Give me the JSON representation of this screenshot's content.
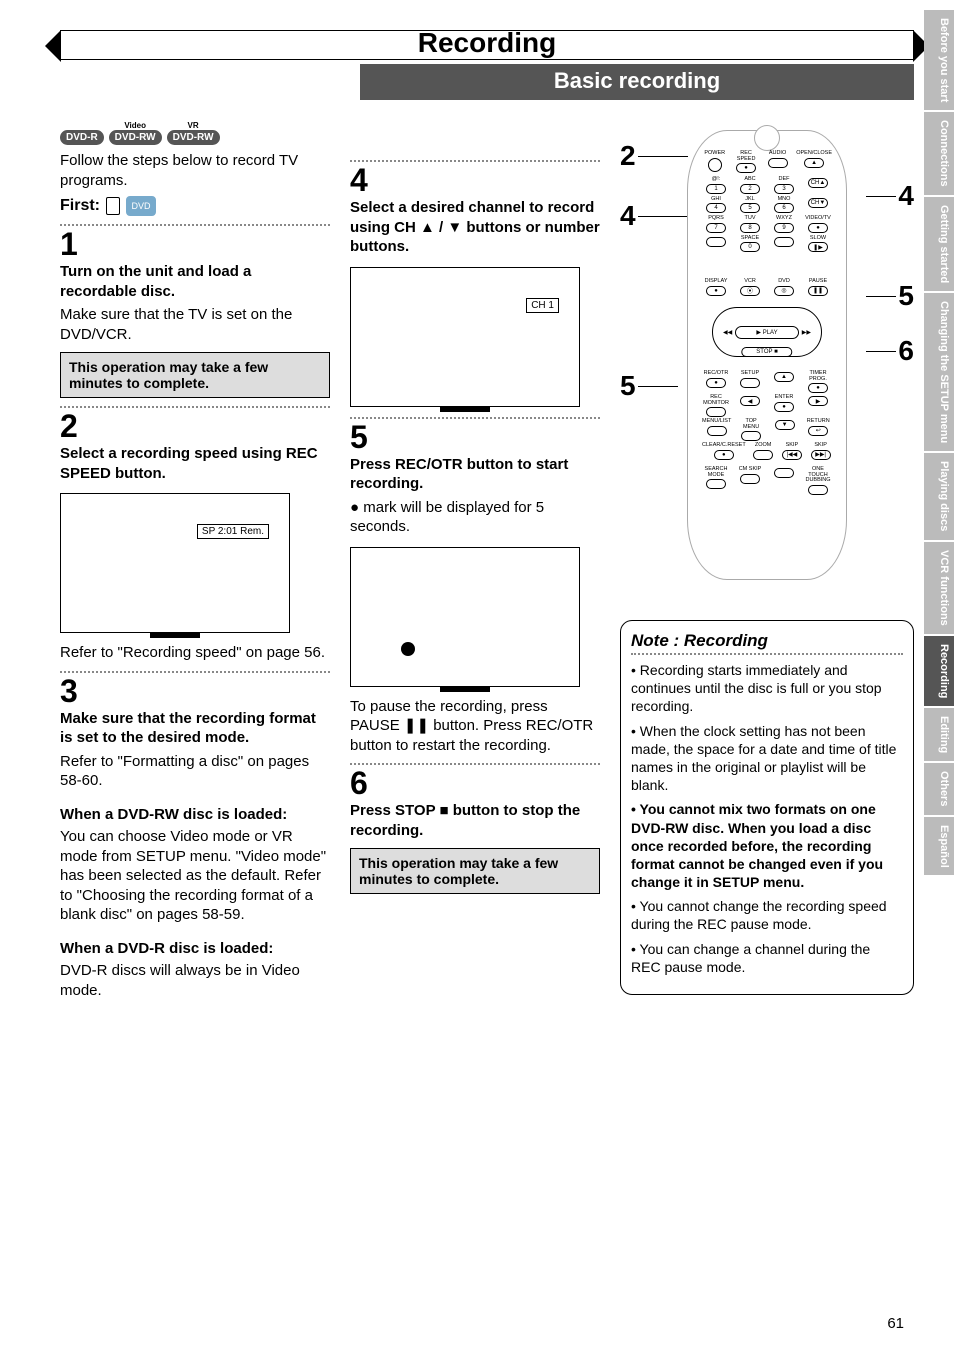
{
  "header": {
    "title": "Recording",
    "subtitle": "Basic recording"
  },
  "badges": [
    {
      "label": "DVD-R",
      "sup": ""
    },
    {
      "label": "DVD-RW",
      "sup": "Video"
    },
    {
      "label": "DVD-RW",
      "sup": "VR"
    }
  ],
  "intro": "Follow the steps below to record TV programs.",
  "first_label": "First:",
  "steps_left": {
    "s1": {
      "num": "1",
      "head": "Turn on the unit and load a recordable disc.",
      "body": "Make sure that the TV is set on the DVD/VCR.",
      "note": "This operation may take a few minutes to complete."
    },
    "s2": {
      "num": "2",
      "head": "Select a recording speed using REC SPEED button.",
      "tv_label": "SP 2:01 Rem.",
      "after": "Refer to \"Recording speed\" on page 56."
    },
    "s3": {
      "num": "3",
      "head": "Make sure that the recording format is set to the desired mode.",
      "body1": "Refer to \"Formatting a disc\" on pages 58-60.",
      "sub1_head": "When a DVD-RW disc is loaded:",
      "sub1_body": "You can choose Video mode or VR mode from SETUP menu. \"Video mode\" has been selected as the default. Refer to \"Choosing the recording format of a blank disc\" on pages 58-59.",
      "sub2_head": "When a DVD-R disc is loaded:",
      "sub2_body": "DVD-R discs will always be in Video mode."
    }
  },
  "steps_mid": {
    "s4": {
      "num": "4",
      "head": "Select a desired channel to record using CH ▲ / ▼ buttons or number buttons.",
      "tv_label": "CH 1"
    },
    "s5": {
      "num": "5",
      "head": "Press REC/OTR button to start recording.",
      "body": "● mark will be displayed for 5 seconds.",
      "after": "To pause the recording, press PAUSE ❚❚ button. Press REC/OTR button to restart the recording."
    },
    "s6": {
      "num": "6",
      "head": "Press STOP ■ button to stop the recording.",
      "note": "This operation may take a few minutes to complete."
    }
  },
  "remote": {
    "top_row": [
      "POWER",
      "REC SPEED",
      "AUDIO",
      "OPEN/CLOSE"
    ],
    "num_labels": [
      [
        "@!:",
        "ABC",
        "DEF",
        ""
      ],
      [
        "GHI",
        "JKL",
        "MNO",
        ""
      ],
      [
        "PQRS",
        "TUV",
        "WXYZ",
        "VIDEO/TV"
      ],
      [
        "",
        "SPACE",
        "",
        "SLOW"
      ]
    ],
    "num_digits": [
      [
        "1",
        "2",
        "3",
        "CH▲"
      ],
      [
        "4",
        "5",
        "6",
        "CH▼"
      ],
      [
        "7",
        "8",
        "9",
        "●"
      ],
      [
        "",
        "0",
        "",
        "❚▶"
      ]
    ],
    "mid_row_labels": [
      "DISPLAY",
      "VCR",
      "DVD",
      "PAUSE"
    ],
    "mid_row_btns": [
      "●",
      "⦿",
      "◎",
      "❚❚"
    ],
    "play": "▶  PLAY",
    "stop": "STOP ■",
    "rew": "◀◀",
    "ff": "▶▶",
    "lower1_labels": [
      "REC/OTR",
      "SETUP",
      "",
      "TIMER PROG."
    ],
    "lower1_btns": [
      "●",
      "",
      "▲",
      "●"
    ],
    "lower2_labels": [
      "REC MONITOR",
      "",
      "ENTER",
      ""
    ],
    "lower2_btns": [
      "",
      "◀",
      "●",
      "▶"
    ],
    "lower3_labels": [
      "MENU/LIST",
      "TOP MENU",
      "",
      "RETURN"
    ],
    "lower3_btns": [
      "",
      "",
      "▼",
      "↩"
    ],
    "lower4_labels": [
      "CLEAR/C.RESET",
      "ZOOM",
      "SKIP",
      "SKIP"
    ],
    "lower4_btns": [
      "●",
      "",
      "|◀◀",
      "▶▶|"
    ],
    "lower5_labels": [
      "SEARCH MODE",
      "CM SKIP",
      "",
      "ONE TOUCH DUBBING"
    ],
    "lower5_btns": [
      "",
      "",
      "",
      ""
    ]
  },
  "callouts": {
    "c2": "2",
    "c4l": "4",
    "c4r": "4",
    "c5l": "5",
    "c5r": "5",
    "c6": "6"
  },
  "note_block": {
    "title": "Note : Recording",
    "items": [
      {
        "text": "Recording starts immediately and continues until the disc is full or you stop recording.",
        "bold": false
      },
      {
        "text": "When the clock setting has not been made, the space for a date and time of title names in the original or playlist will be blank.",
        "bold": false
      },
      {
        "text": "You cannot mix two formats on one DVD-RW disc. When you load a disc once recorded before, the recording format cannot be changed even if you change it in SETUP menu.",
        "bold": true
      },
      {
        "text": "You cannot change the recording speed during the REC pause mode.",
        "bold": false
      },
      {
        "text": "You can change a channel during the REC pause mode.",
        "bold": false
      }
    ]
  },
  "side_tabs": [
    {
      "label": "Before you start",
      "active": false
    },
    {
      "label": "Connections",
      "active": false
    },
    {
      "label": "Getting started",
      "active": false
    },
    {
      "label": "Changing the SETUP menu",
      "active": false
    },
    {
      "label": "Playing discs",
      "active": false
    },
    {
      "label": "VCR functions",
      "active": false
    },
    {
      "label": "Recording",
      "active": true
    },
    {
      "label": "Editing",
      "active": false
    },
    {
      "label": "Others",
      "active": false
    },
    {
      "label": "Español",
      "active": false
    }
  ],
  "page_number": "61"
}
